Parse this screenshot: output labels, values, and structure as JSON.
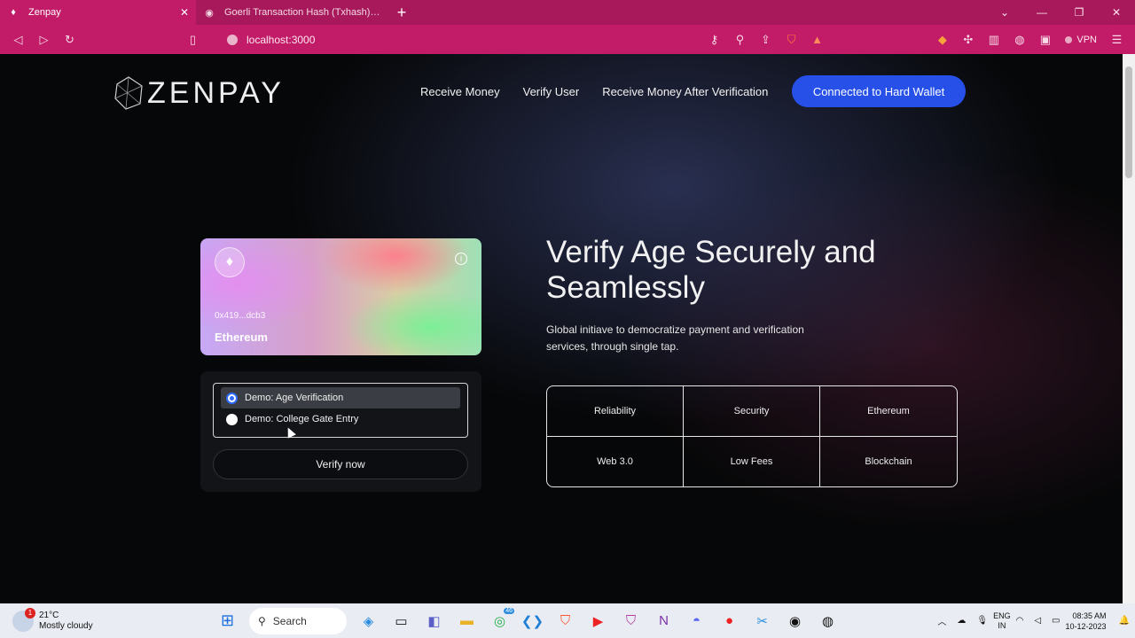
{
  "browser": {
    "tabs": [
      {
        "title": "Zenpay",
        "active": true
      },
      {
        "title": "Goerli Transaction Hash (Txhash) Details |",
        "active": false
      }
    ],
    "url": "localhost:3000",
    "vpn_label": "VPN"
  },
  "header": {
    "logo_text": "ZENPAY",
    "nav": [
      "Receive Money",
      "Verify User",
      "Receive Money After Verification"
    ],
    "wallet_button": "Connected to Hard Wallet"
  },
  "card": {
    "address": "0x419...dcb3",
    "network": "Ethereum"
  },
  "demo": {
    "options": [
      {
        "label": "Demo: Age Verification",
        "selected": true
      },
      {
        "label": "Demo: College Gate Entry",
        "selected": false
      }
    ],
    "verify_button": "Verify now"
  },
  "hero": {
    "title": "Verify Age Securely and Seamlessly",
    "subtitle": "Global initiave to democratize payment and verification services, through single tap."
  },
  "features": [
    "Reliability",
    "Security",
    "Ethereum",
    "Web 3.0",
    "Low Fees",
    "Blockchain"
  ],
  "taskbar": {
    "weather_temp": "21°C",
    "weather_desc": "Mostly cloudy",
    "weather_badge": "1",
    "search_label": "Search",
    "lang_top": "ENG",
    "lang_bottom": "IN",
    "time": "08:35 AM",
    "date": "10-12-2023",
    "whatsapp_badge": "46"
  },
  "colors": {
    "browser_chrome": "#c21b67",
    "wallet_button": "#2650e8",
    "page_bg": "#060708"
  }
}
